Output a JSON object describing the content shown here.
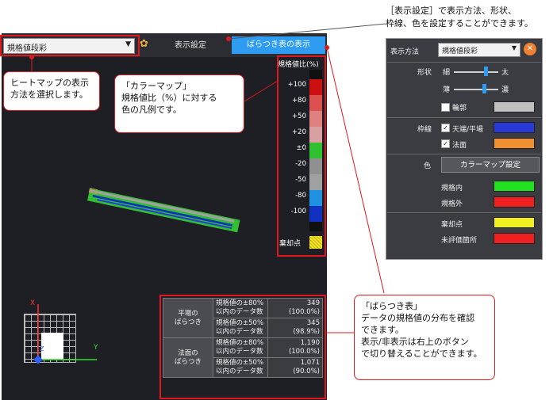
{
  "toolbar": {
    "mode_select_value": "規格値段彩",
    "display_settings_tab": "表示設定",
    "variance_table_button": "ばらつき表の表示"
  },
  "legend": {
    "title": "規格値比(%)",
    "items": [
      {
        "label": "+100",
        "color": "#cc1010"
      },
      {
        "label": "+80",
        "color": "#dd5050"
      },
      {
        "label": "+50",
        "color": "#e08080"
      },
      {
        "label": "+20",
        "color": "#d8a0a0"
      },
      {
        "label": "±0",
        "color": "#30c030"
      },
      {
        "label": "-20",
        "color": "#909090"
      },
      {
        "label": "-50",
        "color": "#a0a0a0"
      },
      {
        "label": "-80",
        "color": "#2090e0"
      },
      {
        "label": "-100",
        "color": "#1030c0"
      }
    ],
    "top_color": "#101010",
    "bottom_color": "#101010",
    "reject_label": "棄却点"
  },
  "axis": {
    "x": "X",
    "y": "Y",
    "z": "Z"
  },
  "variance_table": {
    "rows": [
      {
        "group": "平場の\nばらつき",
        "desc": "規格値の±80%\n以内のデータ数",
        "count": "349",
        "pct": "(100.0%)"
      },
      {
        "group": "",
        "desc": "規格値の±50%\n以内のデータ数",
        "count": "345",
        "pct": "(98.9%)"
      },
      {
        "group": "法面の\nばらつき",
        "desc": "規格値の±80%\n以内のデータ数",
        "count": "1,190",
        "pct": "(100.0%)"
      },
      {
        "group": "",
        "desc": "規格値の±50%\n以内のデータ数",
        "count": "1,071",
        "pct": "(90.0%)"
      }
    ]
  },
  "callouts": {
    "heatmap_line1": "ヒートマップの表示",
    "heatmap_line2": "方法を選択します。",
    "colormap_title": "「カラーマップ」",
    "colormap_line1": "規格値比（%）に対する",
    "colormap_line2": "色の凡例です。",
    "variance_title": "「ばらつき表」",
    "variance_line1": "データの規格値の分布を確認",
    "variance_line2": "できます。",
    "variance_line3": "表示/非表示は右上のボタン",
    "variance_line4": "で切り替えることができます。",
    "top_line1": "［表示設定］で表示方法、形状、",
    "top_line2": "枠線、色を設定することができます。"
  },
  "settings_dialog": {
    "method_label": "表示方法",
    "method_value": "規格値段彩",
    "shape_label": "形状",
    "thin": "細",
    "thick": "太",
    "light": "薄",
    "dark": "濃",
    "outline": "輪郭",
    "frame_label": "枠線",
    "top_flat": "天端/平場",
    "slope": "法面",
    "color_label": "色",
    "colormap_button": "カラーマップ設定",
    "in_spec": "規格内",
    "out_spec": "規格外",
    "reject_point": "棄却点",
    "unevaluated": "未評価箇所",
    "colors": {
      "outline": "#c0c0c0",
      "top_flat": "#2a3ad8",
      "slope": "#f09030",
      "in_spec": "#20e020",
      "out_spec": "#f02020",
      "reject_point": "#f0f020",
      "unevaluated": "#f02020"
    }
  }
}
